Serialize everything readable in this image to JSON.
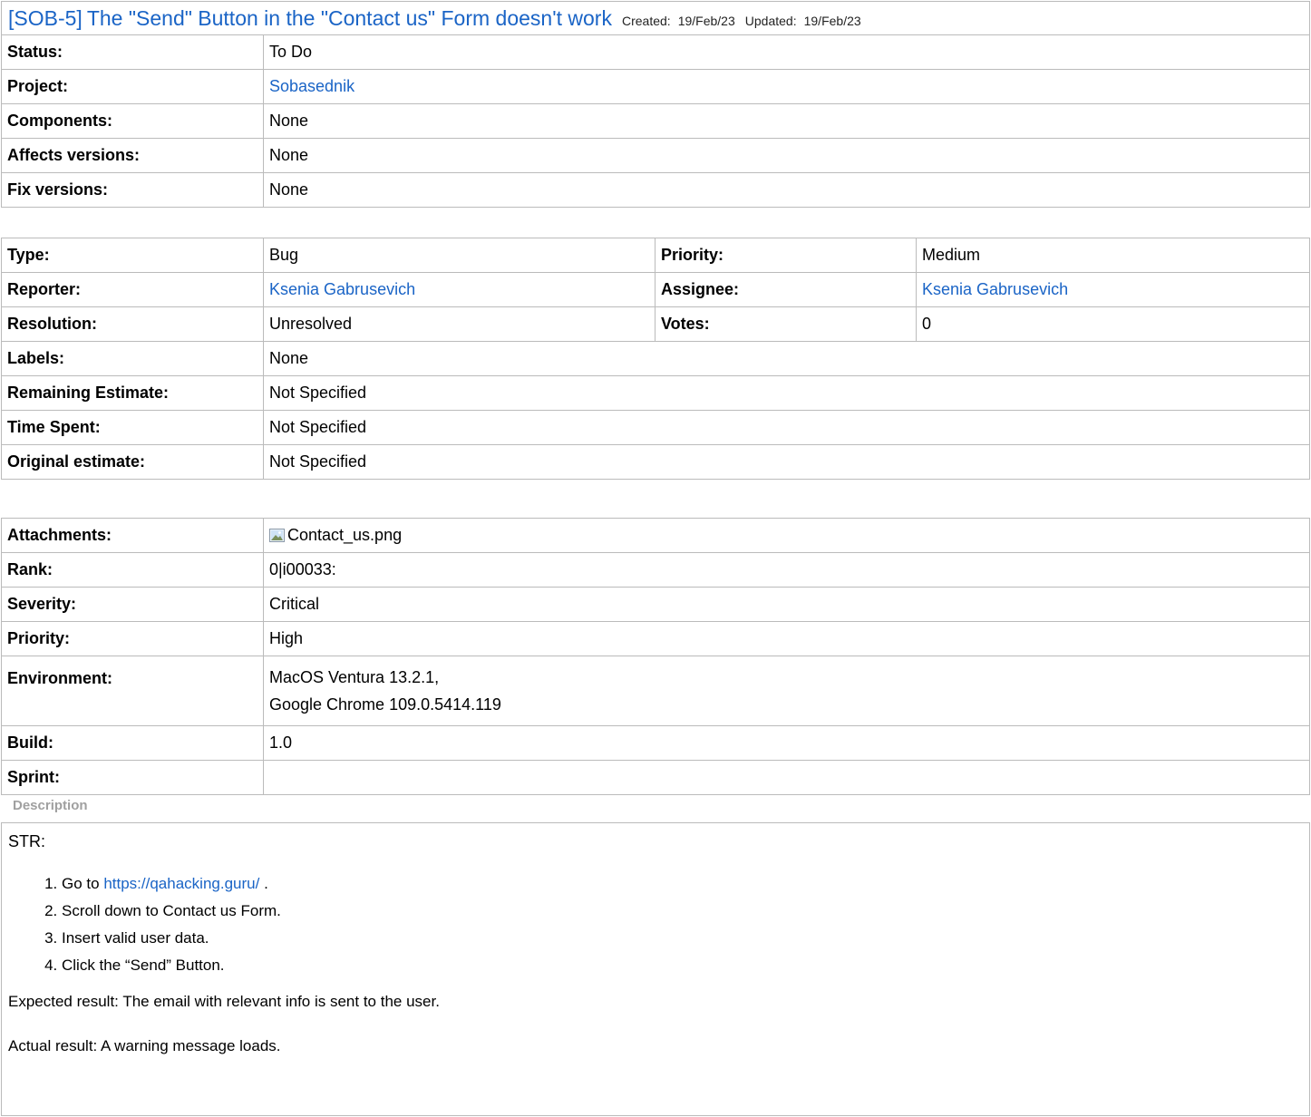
{
  "issue": {
    "key": "[SOB-5]",
    "title": "The \"Send\" Button in the \"Contact us\" Form doesn't work",
    "created_label": "Created:",
    "created": "19/Feb/23",
    "updated_label": "Updated:",
    "updated": "19/Feb/23"
  },
  "fields1": [
    {
      "label": "Status:",
      "value": "To Do",
      "link": false
    },
    {
      "label": "Project:",
      "value": "Sobasednik",
      "link": true
    },
    {
      "label": "Components:",
      "value": "None",
      "link": false
    },
    {
      "label": "Affects versions:",
      "value": "None",
      "link": false
    },
    {
      "label": "Fix versions:",
      "value": "None",
      "link": false
    }
  ],
  "fields2": {
    "type_label": "Type:",
    "type": "Bug",
    "priority_label": "Priority:",
    "priority": "Medium",
    "reporter_label": "Reporter:",
    "reporter": "Ksenia Gabrusevich",
    "assignee_label": "Assignee:",
    "assignee": "Ksenia Gabrusevich",
    "resolution_label": "Resolution:",
    "resolution": "Unresolved",
    "votes_label": "Votes:",
    "votes": "0",
    "labels_label": "Labels:",
    "labels": "None",
    "remaining_label": "Remaining Estimate:",
    "remaining": "Not Specified",
    "timespent_label": "Time Spent:",
    "timespent": "Not Specified",
    "original_label": "Original estimate:",
    "original": "Not Specified"
  },
  "fields3": {
    "attachments_label": "Attachments:",
    "attachment_file": "Contact_us.png",
    "attachment_icon": "image-file-icon",
    "rank_label": "Rank:",
    "rank": "0|i00033:",
    "severity_label": "Severity:",
    "severity": "Critical",
    "priority_label": "Priority:",
    "priority": "High",
    "environment_label": "Environment:",
    "environment_line1": "MacOS Ventura 13.2.1,",
    "environment_line2": "Google Chrome 109.0.5414.119",
    "build_label": "Build:",
    "build": "1.0",
    "sprint_label": "Sprint:",
    "sprint": ""
  },
  "description": {
    "heading": "Description",
    "str": "STR:",
    "step1_prefix": "Go to",
    "step1_link": "https://qahacking.guru/",
    "step1_suffix": ".",
    "step2": "Scroll down to Contact us Form.",
    "step3": "Insert valid user data.",
    "step4": "Click the “Send” Button.",
    "expected": "Expected result: The email with relevant info is sent to the user.",
    "actual": "Actual result: A warning message loads."
  },
  "colors": {
    "link": "#1a64c6",
    "border": "#bbbbbb",
    "muted": "#a0a0a0"
  }
}
